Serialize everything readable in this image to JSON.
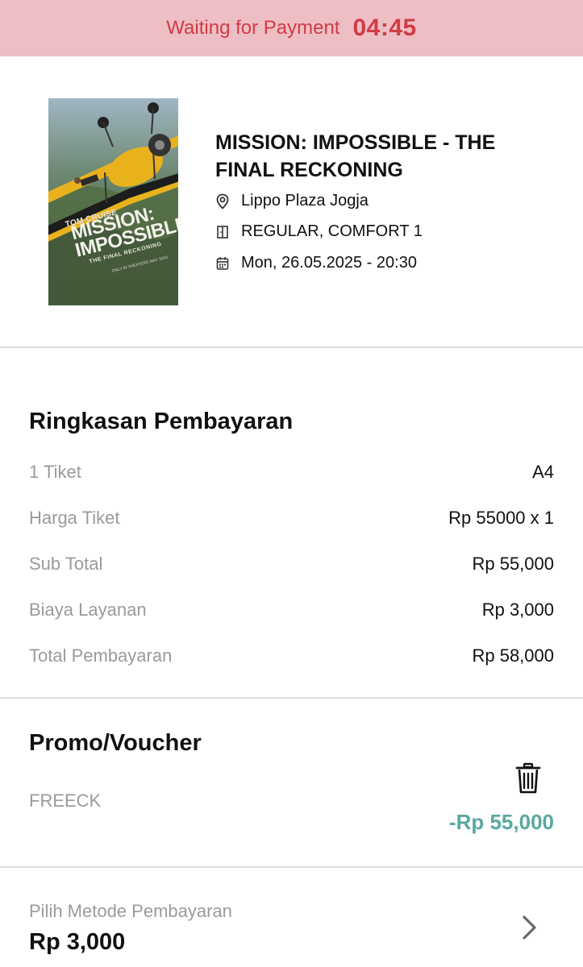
{
  "banner": {
    "label": "Waiting for Payment",
    "timer": "04:45",
    "color": "#d23b46",
    "background": "#eebec5"
  },
  "movie": {
    "title": "MISSION: IMPOSSIBLE - THE FINAL RECKONING",
    "location": "Lippo Plaza Jogja",
    "studio": "REGULAR, COMFORT 1",
    "datetime": "Mon, 26.05.2025 - 20:30",
    "poster": {
      "actor": "TOM CRUISE",
      "title_line1": "MISSION:",
      "title_line2": "IMPOSSIBLE",
      "subtitle": "THE FINAL RECKONING",
      "release": "ONLY IN THEATERS MAY 2025"
    },
    "icons": {
      "location": "location-pin-icon",
      "studio": "door-icon",
      "datetime": "calendar-icon"
    }
  },
  "summary": {
    "title": "Ringkasan Pembayaran",
    "rows": [
      {
        "label": "1 Tiket",
        "value": "A4"
      },
      {
        "label": "Harga Tiket",
        "value": "Rp 55000 x 1"
      },
      {
        "label": "Sub Total",
        "value": "Rp 55,000"
      },
      {
        "label": "Biaya Layanan",
        "value": "Rp 3,000"
      },
      {
        "label": "Total Pembayaran",
        "value": "Rp 58,000"
      }
    ]
  },
  "promo": {
    "title": "Promo/Voucher",
    "code": "FREECK",
    "amount": "-Rp 55,000",
    "amount_color": "#5aa8a0",
    "icon": "trash-icon"
  },
  "payment": {
    "label": "Pilih Metode Pembayaran",
    "amount": "Rp 3,000",
    "icon": "chevron-right-icon"
  }
}
